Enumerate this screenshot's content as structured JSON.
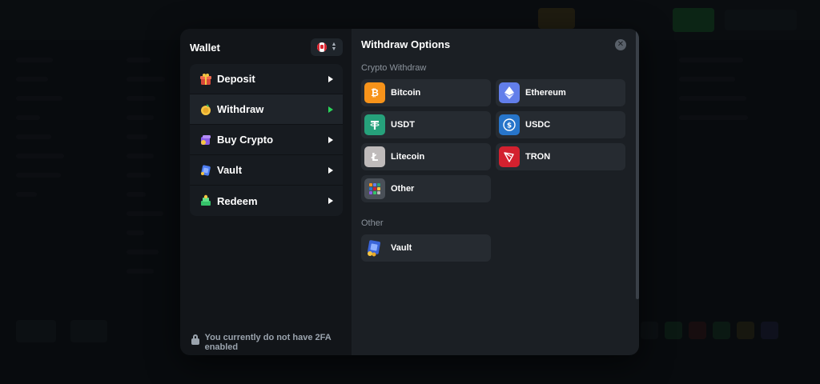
{
  "wallet": {
    "title": "Wallet",
    "currency_flag": "canada-flag-icon",
    "menu": [
      {
        "label": "Deposit",
        "icon": "deposit-icon",
        "active": false
      },
      {
        "label": "Withdraw",
        "icon": "withdraw-icon",
        "active": true
      },
      {
        "label": "Buy Crypto",
        "icon": "buy-crypto-icon",
        "active": false
      },
      {
        "label": "Vault",
        "icon": "vault-icon",
        "active": false
      },
      {
        "label": "Redeem",
        "icon": "redeem-icon",
        "active": false
      }
    ],
    "twofa_notice": "You currently do not have 2FA enabled"
  },
  "withdraw": {
    "title": "Withdraw Options",
    "crypto_section": "Crypto Withdraw",
    "crypto_options": [
      {
        "name": "Bitcoin",
        "icon": "bitcoin-icon",
        "color": "#f7931a"
      },
      {
        "name": "Ethereum",
        "icon": "ethereum-icon",
        "color": "#627eea"
      },
      {
        "name": "USDT",
        "icon": "usdt-icon",
        "color": "#26a17b"
      },
      {
        "name": "USDC",
        "icon": "usdc-icon",
        "color": "#2775ca"
      },
      {
        "name": "Litecoin",
        "icon": "litecoin-icon",
        "color": "#bfbbbb"
      },
      {
        "name": "TRON",
        "icon": "tron-icon",
        "color": "#d3212f"
      },
      {
        "name": "Other",
        "icon": "other-coins-icon",
        "color": "#4a5058"
      }
    ],
    "other_section": "Other",
    "other_options": [
      {
        "name": "Vault",
        "icon": "vault-icon",
        "color": "#3a64d8"
      }
    ]
  },
  "colors": {
    "accent_green": "#29d45a",
    "panel_left": "#121519",
    "panel_right": "#1b1f24",
    "option_bg": "#262b31"
  }
}
